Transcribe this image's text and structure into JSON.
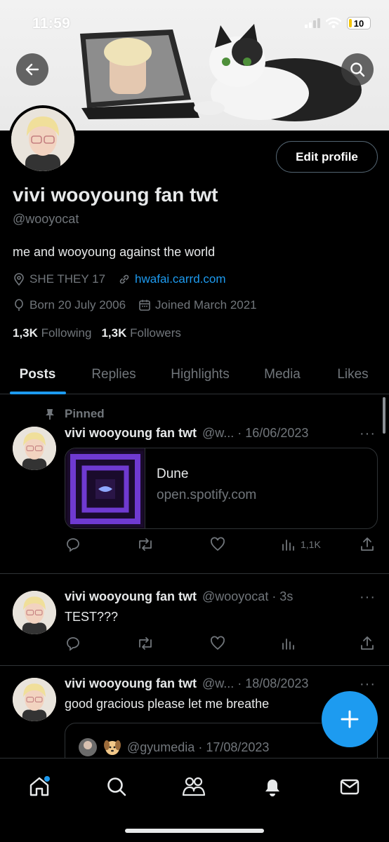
{
  "status_bar": {
    "time": "11:59",
    "battery": "10"
  },
  "header": {
    "back_icon": "arrow-left-icon",
    "search_icon": "search-icon"
  },
  "profile": {
    "edit_button": "Edit profile",
    "display_name": "vivi wooyoung fan twt",
    "handle": "@wooyocat",
    "bio": "me and wooyoung against the world",
    "location": "SHE THEY 17",
    "website": "hwafai.carrd.com",
    "birthday": "Born 20 July 2006",
    "joined": "Joined March 2021",
    "following_count": "1,3K",
    "following_label": "Following",
    "followers_count": "1,3K",
    "followers_label": "Followers"
  },
  "tabs": [
    {
      "label": "Posts",
      "active": true
    },
    {
      "label": "Replies"
    },
    {
      "label": "Highlights"
    },
    {
      "label": "Media"
    },
    {
      "label": "Likes"
    }
  ],
  "posts": [
    {
      "pinned_label": "Pinned",
      "name": "vivi wooyoung fan twt",
      "meta": "@w... · 16/06/2023",
      "card_title": "Dune",
      "card_domain": "open.spotify.com",
      "views": "1,1K"
    },
    {
      "name": "vivi wooyoung fan twt",
      "meta": "@wooyocat · 3s",
      "text": "TEST???"
    },
    {
      "name": "vivi wooyoung fan twt",
      "meta": "@w... · 18/08/2023",
      "text": "good gracious please let me breathe",
      "quote_meta": "@gyumedia · 17/08/2023"
    }
  ],
  "more_label": "···",
  "colors": {
    "accent": "#1d9bf0",
    "muted": "#71767b",
    "background": "#000000",
    "text": "#e7e9ea",
    "border": "#2f3336"
  }
}
